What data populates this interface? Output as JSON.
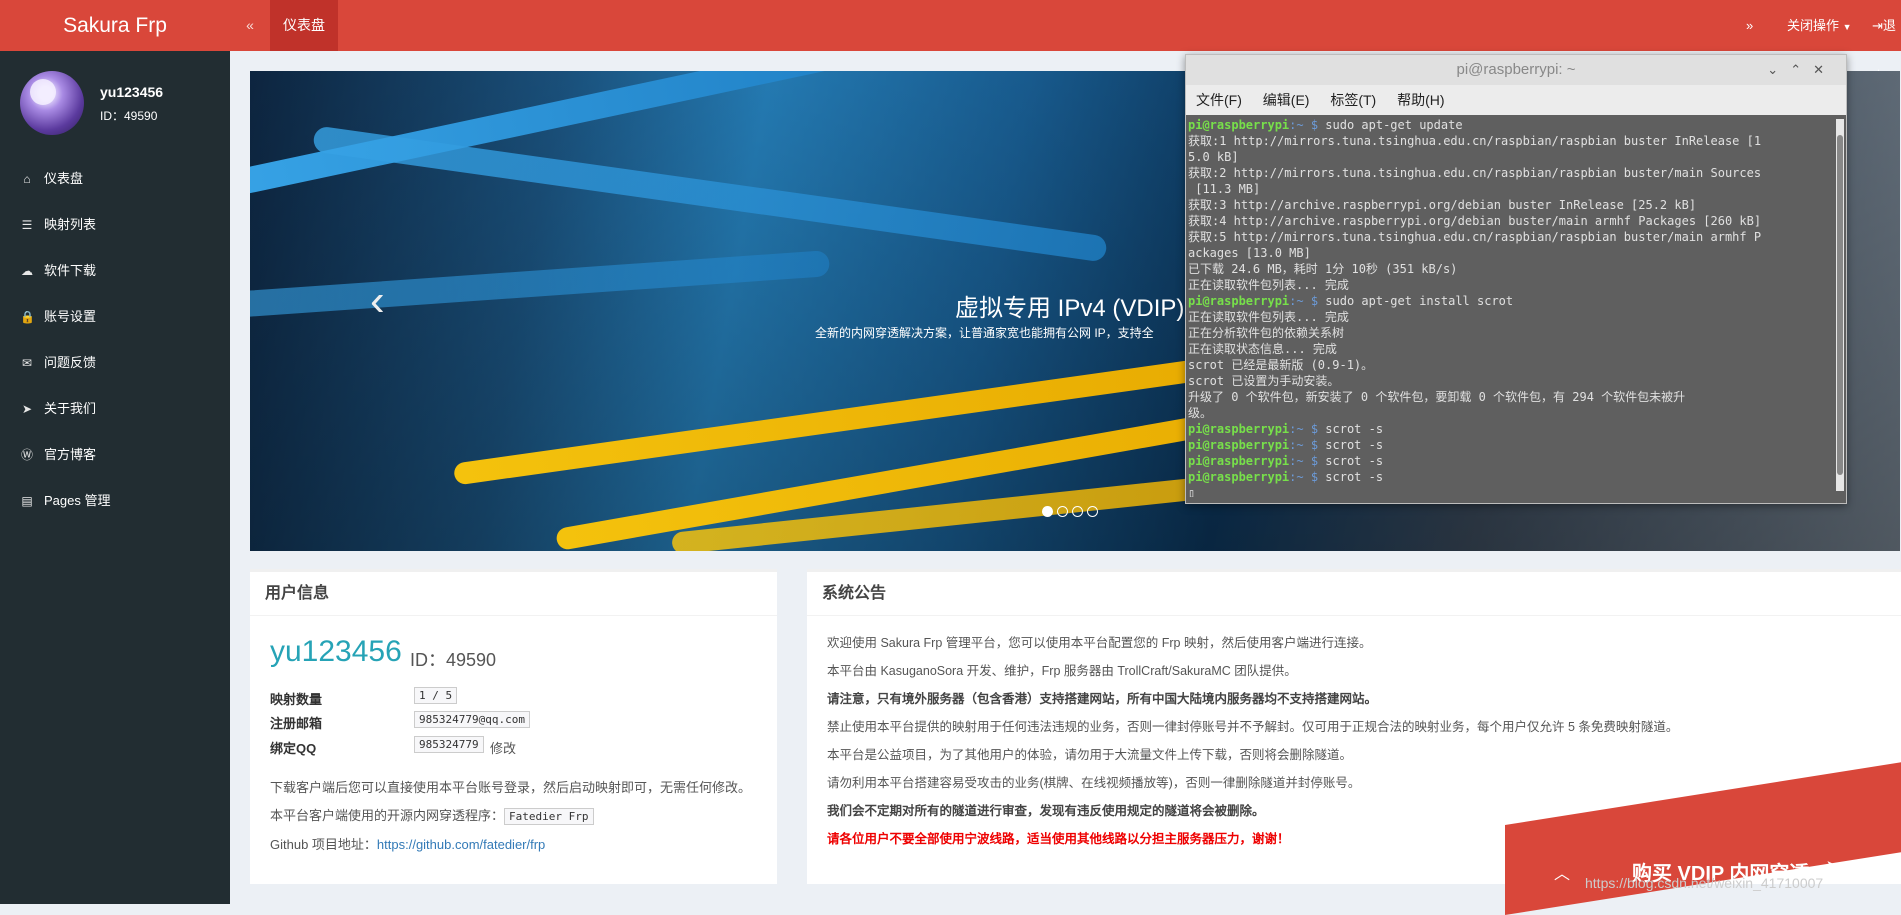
{
  "header": {
    "brand": "Sakura Frp",
    "toggle_icon": "«",
    "active_tab": "仪表盘",
    "right_icon": "»",
    "right_menu": "关闭操作",
    "logout": "退出"
  },
  "sidebar": {
    "username": "yu123456",
    "id_label": "ID：49590",
    "items": [
      {
        "icon": "home-icon",
        "glyph": "⌂",
        "label": "仪表盘"
      },
      {
        "icon": "list-icon",
        "glyph": "☰",
        "label": "映射列表"
      },
      {
        "icon": "cloud-download-icon",
        "glyph": "☁",
        "label": "软件下载"
      },
      {
        "icon": "lock-icon",
        "glyph": "🔒",
        "label": "账号设置"
      },
      {
        "icon": "envelope-icon",
        "glyph": "✉",
        "label": "问题反馈"
      },
      {
        "icon": "send-icon",
        "glyph": "➤",
        "label": "关于我们"
      },
      {
        "icon": "wordpress-icon",
        "glyph": "Ⓦ",
        "label": "官方博客"
      },
      {
        "icon": "file-icon",
        "glyph": "▤",
        "label": "Pages 管理"
      }
    ]
  },
  "carousel": {
    "title": "虚拟专用 IPv4 (VDIP)",
    "subtitle": "全新的内网穿透解决方案，让普通家宽也能拥有公网 IP，支持全",
    "prev": "‹",
    "active_index": 0,
    "slide_count": 4
  },
  "terminal": {
    "title": "pi@raspberrypi: ~",
    "menu": [
      "文件(F)",
      "编辑(E)",
      "标签(T)",
      "帮助(H)"
    ],
    "prompt_user": "pi@raspberrypi",
    "lines": [
      {
        "type": "cmd",
        "text": "sudo apt-get update"
      },
      {
        "type": "out",
        "text": "获取:1 http://mirrors.tuna.tsinghua.edu.cn/raspbian/raspbian buster InRelease [1"
      },
      {
        "type": "out",
        "text": "5.0 kB]"
      },
      {
        "type": "out",
        "text": "获取:2 http://mirrors.tuna.tsinghua.edu.cn/raspbian/raspbian buster/main Sources"
      },
      {
        "type": "out",
        "text": " [11.3 MB]"
      },
      {
        "type": "out",
        "text": "获取:3 http://archive.raspberrypi.org/debian buster InRelease [25.2 kB]"
      },
      {
        "type": "out",
        "text": "获取:4 http://archive.raspberrypi.org/debian buster/main armhf Packages [260 kB]"
      },
      {
        "type": "out",
        "text": "获取:5 http://mirrors.tuna.tsinghua.edu.cn/raspbian/raspbian buster/main armhf P"
      },
      {
        "type": "out",
        "text": "ackages [13.0 MB]"
      },
      {
        "type": "out",
        "text": "已下载 24.6 MB，耗时 1分 10秒 (351 kB/s)"
      },
      {
        "type": "out",
        "text": "正在读取软件包列表... 完成"
      },
      {
        "type": "cmd",
        "text": "sudo apt-get install scrot"
      },
      {
        "type": "out",
        "text": "正在读取软件包列表... 完成"
      },
      {
        "type": "out",
        "text": "正在分析软件包的依赖关系树"
      },
      {
        "type": "out",
        "text": "正在读取状态信息... 完成"
      },
      {
        "type": "out",
        "text": "scrot 已经是最新版 (0.9-1)。"
      },
      {
        "type": "out",
        "text": "scrot 已设置为手动安装。"
      },
      {
        "type": "out",
        "text": "升级了 0 个软件包，新安装了 0 个软件包，要卸载 0 个软件包，有 294 个软件包未被升"
      },
      {
        "type": "out",
        "text": "级。"
      },
      {
        "type": "cmd",
        "text": "scrot -s"
      },
      {
        "type": "cmd",
        "text": "scrot -s"
      },
      {
        "type": "cmd",
        "text": "scrot -s"
      },
      {
        "type": "cmd",
        "text": "scrot -s"
      },
      {
        "type": "cursor",
        "text": "▯"
      }
    ]
  },
  "user_info": {
    "title": "用户信息",
    "name": "yu123456",
    "id_text": "ID：49590",
    "mapping_label": "映射数量",
    "mapping_value": "1 / 5",
    "email_label": "注册邮箱",
    "email_value": "985324779@qq.com",
    "qq_label": "绑定QQ",
    "qq_value": "985324779",
    "qq_edit": "修改",
    "line1": "下载客户端后您可以直接使用本平台账号登录，然后启动映射即可，无需任何修改。",
    "line2_prefix": "本平台客户端使用的开源内网穿透程序：",
    "line2_code": "Fatedier Frp",
    "line3_prefix": "Github 项目地址：",
    "line3_link": "https://github.com/fatedier/frp"
  },
  "notice": {
    "title": "系统公告",
    "lines": [
      {
        "style": "n",
        "text": "欢迎使用 Sakura Frp 管理平台，您可以使用本平台配置您的 Frp 映射，然后使用客户端进行连接。"
      },
      {
        "style": "n",
        "text": "本平台由 KasuganoSora 开发、维护，Frp 服务器由 TrollCraft/SakuraMC 团队提供。"
      },
      {
        "style": "b",
        "text": "请注意，只有境外服务器（包含香港）支持搭建网站，所有中国大陆境内服务器均不支持搭建网站。"
      },
      {
        "style": "n",
        "text": "禁止使用本平台提供的映射用于任何违法违规的业务，否则一律封停账号并不予解封。仅可用于正规合法的映射业务，每个用户仅允许 5 条免费映射隧道。"
      },
      {
        "style": "n",
        "text": "本平台是公益项目，为了其他用户的体验，请勿用于大流量文件上传下载，否则将会删除隧道。"
      },
      {
        "style": "n",
        "text": "请勿利用本平台搭建容易受攻击的业务(棋牌、在线视频播放等)，否则一律删除隧道并封停账号。"
      },
      {
        "style": "b",
        "text": "我们会不定期对所有的隧道进行审查，发现有违反使用规定的隧道将会被删除。"
      },
      {
        "style": "r",
        "text": "请各位用户不要全部使用宁波线路，适当使用其他线路以分担主服务器压力，谢谢！"
      }
    ]
  },
  "buy_banner": {
    "text": "购买 VDIP 内网穿透",
    "up_icon": "︿",
    "plane_icon": "➤"
  },
  "watermark": "https://blog.csdn.net/weixin_41710007",
  "colors": {
    "brand": "#d9473a",
    "sidebar": "#222d32",
    "accent": "#26a3b6"
  }
}
